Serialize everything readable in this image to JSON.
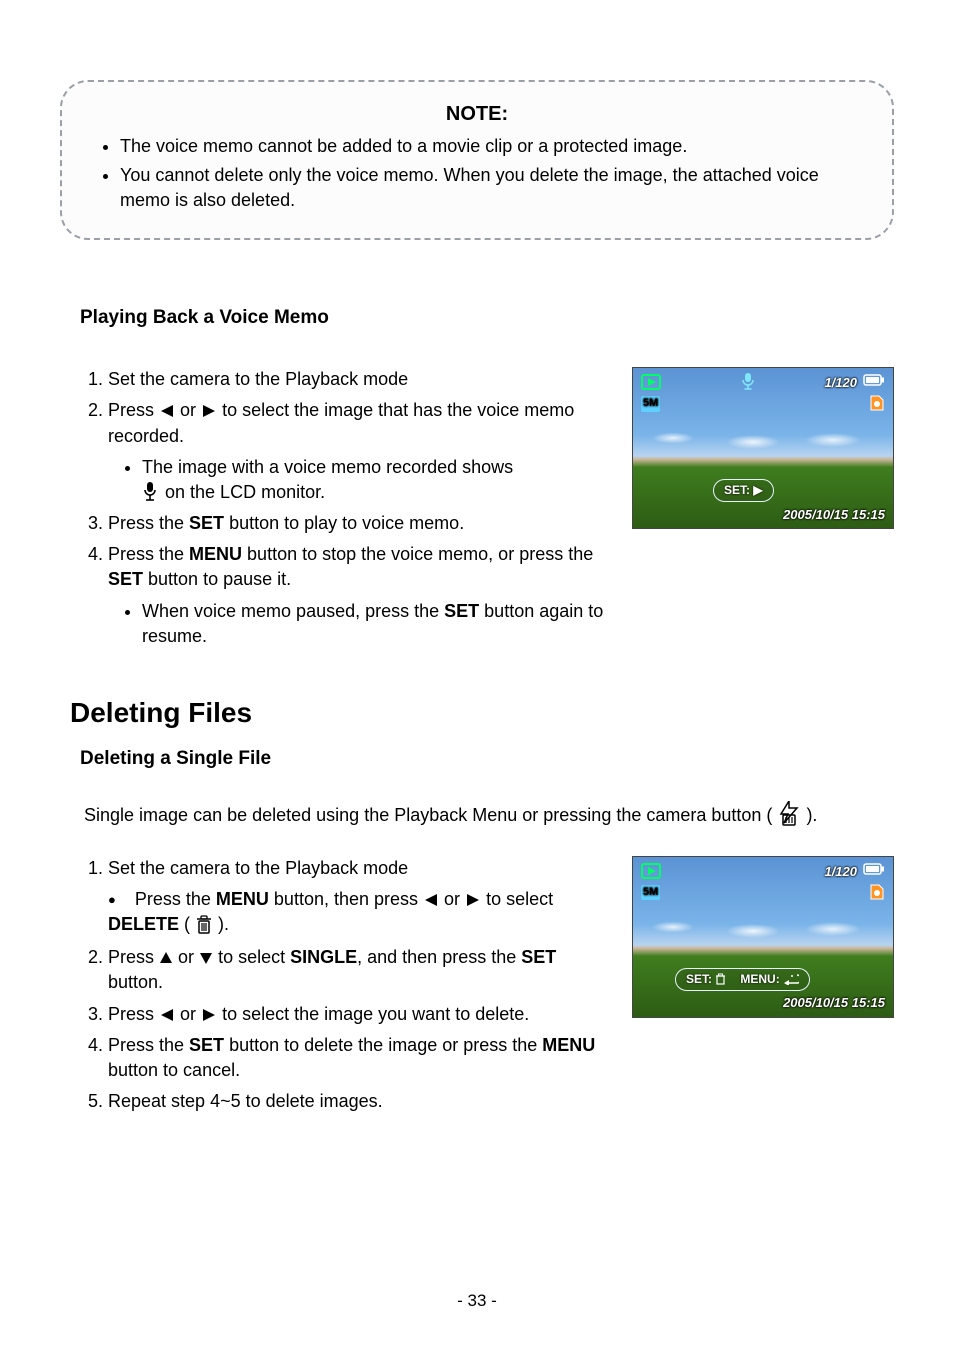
{
  "note": {
    "title": "NOTE:",
    "items": [
      "The voice memo cannot be added to a movie clip or a protected image.",
      "You cannot delete only the voice memo. When you delete the image, the attached voice memo is also deleted."
    ]
  },
  "playback": {
    "heading": "Playing Back a Voice Memo",
    "step1": "Set the camera to the Playback mode",
    "step2_a": "Press ",
    "step2_b": " or ",
    "step2_c": " to select the image that has the voice memo recorded.",
    "sub2_a": "The image with a voice memo recorded shows",
    "sub2_b": " on the LCD monitor.",
    "step3_a": "Press the ",
    "step3_set": "SET",
    "step3_b": " button to play to voice memo.",
    "step4_a": "Press the ",
    "step4_menu": "MENU",
    "step4_b": " button to stop the voice memo, or press the ",
    "step4_set": "SET",
    "step4_c": " button to pause it.",
    "sub4_a": "When voice memo paused, press the ",
    "sub4_set": "SET",
    "sub4_b": " button again to resume."
  },
  "deleting": {
    "heading": "Deleting Files",
    "sub_heading": "Deleting a Single File",
    "intro_a": "Single image can be deleted using the Playback Menu or pressing the camera button ( ",
    "intro_b": ").",
    "step1": "Set the camera to the Playback mode",
    "bullet1_a": "Press the ",
    "bullet1_menu": "MENU",
    "bullet1_b": " button, then press ",
    "bullet1_c": " or ",
    "bullet1_d": " to select ",
    "bullet1_delete": "DELETE",
    "bullet1_e": " (",
    "bullet1_f": ").",
    "step2_a": "Press ",
    "step2_b": " or ",
    "step2_c": " to select ",
    "step2_single": "SINGLE",
    "step2_d": ", and then press the ",
    "step2_set": "SET",
    "step2_e": " button.",
    "step3_a": "Press ",
    "step3_b": " or ",
    "step3_c": " to select the image you want to delete.",
    "step4_a": "Press the ",
    "step4_set": "SET",
    "step4_b": " button to delete the image or press the ",
    "step4_menu": "MENU",
    "step4_c": " button to cancel.",
    "step5": "Repeat step 4~5 to delete images."
  },
  "lcd": {
    "size_badge": "5M",
    "counter": "1/120",
    "set_label_play": "SET: ▶",
    "set_label_trash": "SET:",
    "menu_label": "MENU:",
    "timestamp": "2005/10/15  15:15"
  },
  "page_number": "- 33 -"
}
